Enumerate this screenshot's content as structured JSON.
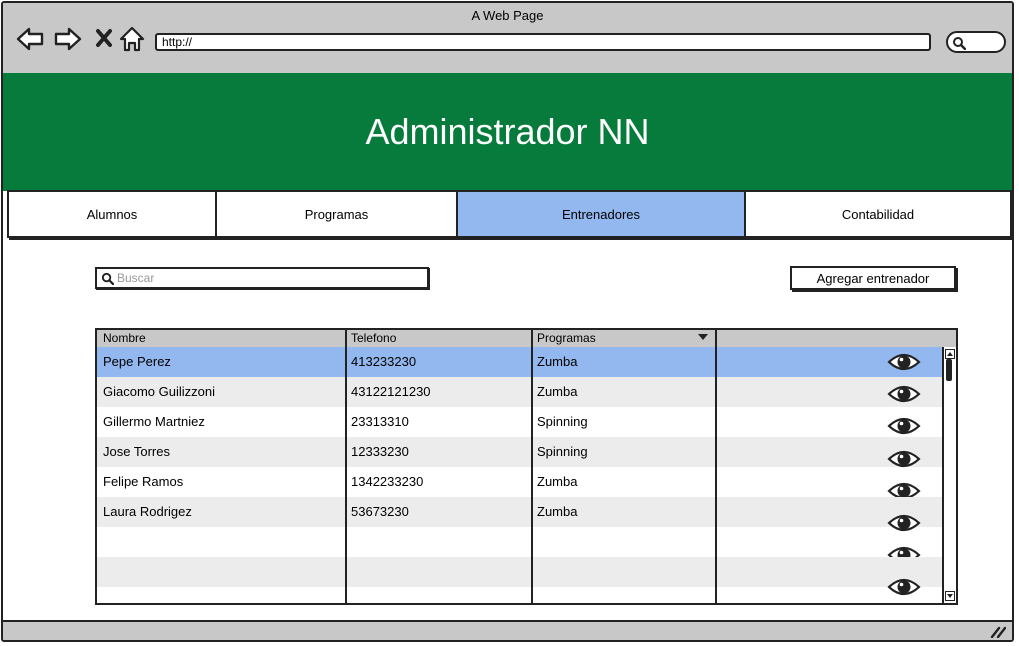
{
  "window": {
    "title": "A Web Page"
  },
  "browser": {
    "url": "http://"
  },
  "header": {
    "title": "Administrador NN",
    "background": "#077b3b"
  },
  "tabs": [
    {
      "label": "Alumnos",
      "active": false
    },
    {
      "label": "Programas",
      "active": false
    },
    {
      "label": "Entrenadores",
      "active": true
    },
    {
      "label": "Contabilidad",
      "active": false
    }
  ],
  "search": {
    "placeholder": "Buscar",
    "value": ""
  },
  "actions": {
    "add_trainer": "Agregar entrenador"
  },
  "table": {
    "columns": [
      "Nombre",
      "Telefono",
      "Programas",
      ""
    ],
    "rows": [
      {
        "nombre": "Pepe Perez",
        "telefono": "413233230",
        "programa": "Zumba",
        "selected": true
      },
      {
        "nombre": "Giacomo Guilizzoni",
        "telefono": "43122121230",
        "programa": "Zumba"
      },
      {
        "nombre": "Gillermo Martniez",
        "telefono": "23313310",
        "programa": "Spinning"
      },
      {
        "nombre": "Jose Torres",
        "telefono": "12333230",
        "programa": "Spinning"
      },
      {
        "nombre": "Felipe Ramos",
        "telefono": "1342233230",
        "programa": "Zumba"
      },
      {
        "nombre": "Laura Rodrigez",
        "telefono": "53673230",
        "programa": "Zumba"
      },
      {
        "nombre": "",
        "telefono": "",
        "programa": ""
      },
      {
        "nombre": "",
        "telefono": "",
        "programa": ""
      },
      {
        "nombre": "",
        "telefono": "",
        "programa": ""
      }
    ],
    "row_action_icon": "eye-icon",
    "selected_color": "#93b8ef"
  }
}
